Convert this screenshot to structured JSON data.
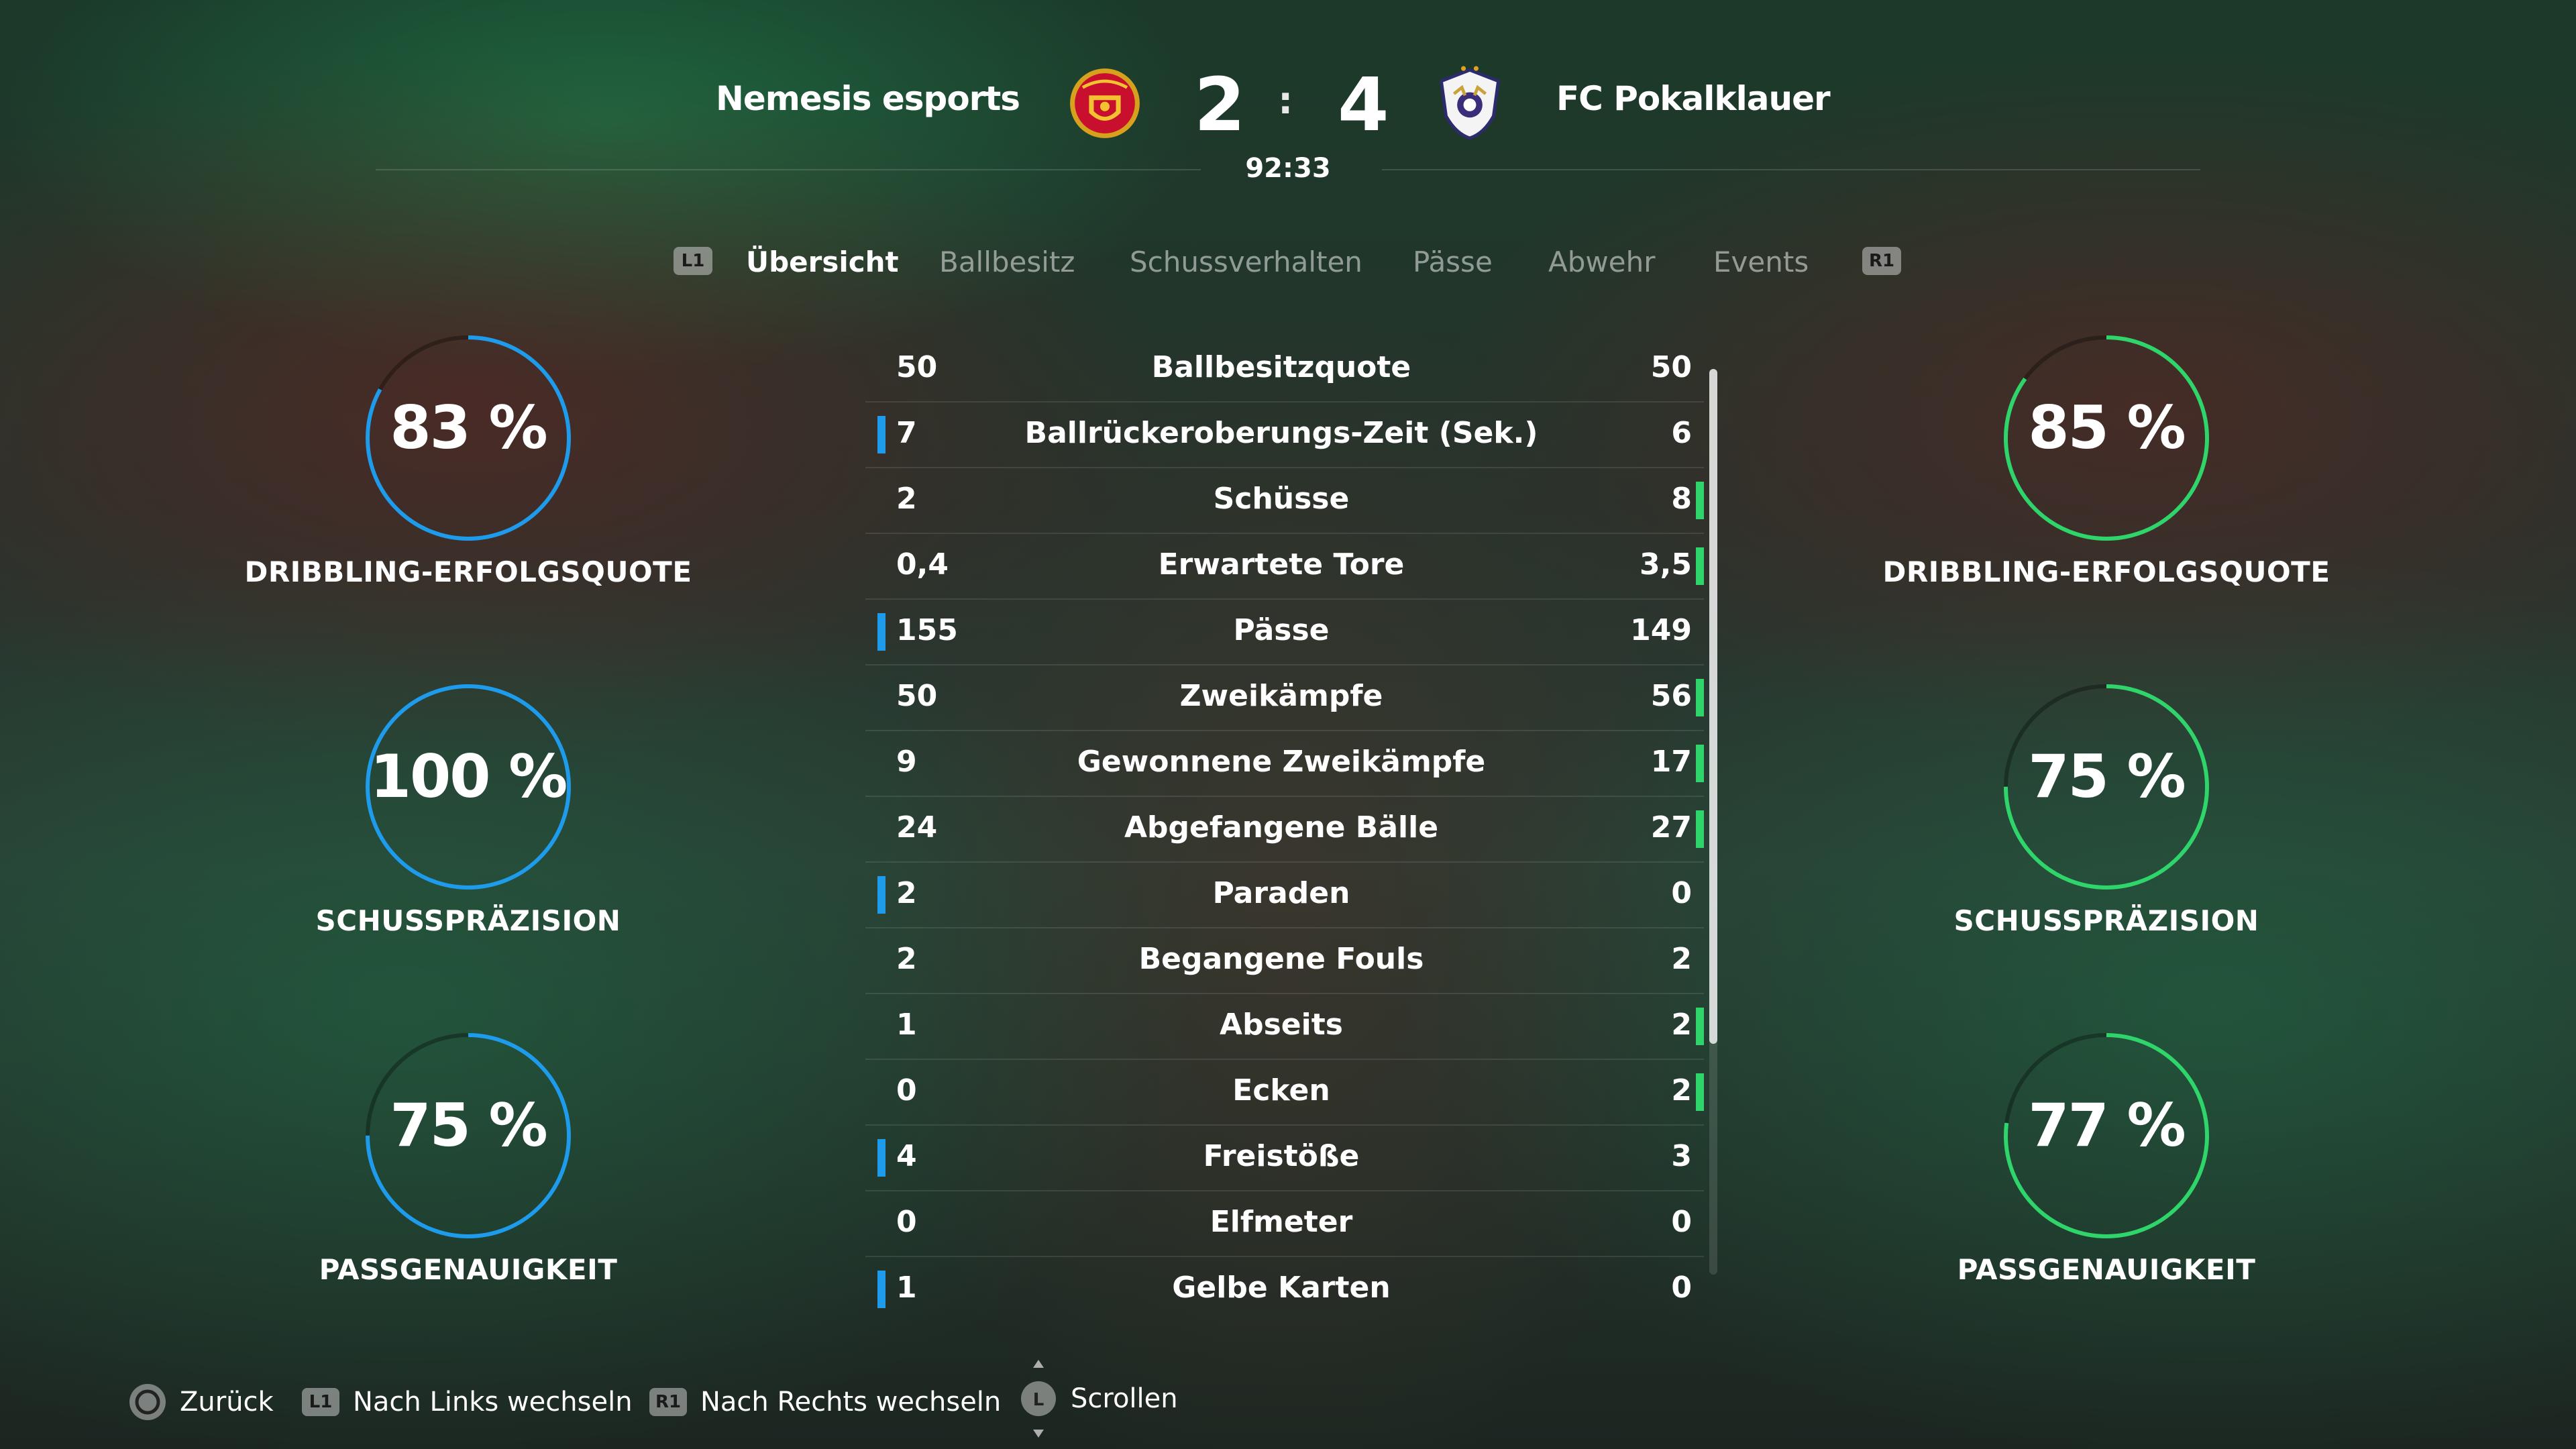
{
  "match": {
    "home_team": "Nemesis esports",
    "away_team": "FC Pokalklauer",
    "home_score": "2",
    "away_score": "4",
    "separator": ":",
    "clock": "92:33",
    "home_color": "#1e9bea",
    "away_color": "#2fd56a"
  },
  "tabs": {
    "prev_key": "L1",
    "next_key": "R1",
    "items": [
      {
        "label": "Übersicht",
        "active": true
      },
      {
        "label": "Ballbesitz",
        "active": false
      },
      {
        "label": "Schussverhalten",
        "active": false
      },
      {
        "label": "Pässe",
        "active": false
      },
      {
        "label": "Abwehr",
        "active": false
      },
      {
        "label": "Events",
        "active": false
      }
    ]
  },
  "home_rings": [
    {
      "value": "83 %",
      "pct": 0.83,
      "label": "DRIBBLING-ERFOLGSQUOTE"
    },
    {
      "value": "100 %",
      "pct": 1.0,
      "label": "SCHUSSPRÄZISION"
    },
    {
      "value": "75 %",
      "pct": 0.75,
      "label": "PASSGENAUIGKEIT"
    }
  ],
  "away_rings": [
    {
      "value": "85 %",
      "pct": 0.85,
      "label": "DRIBBLING-ERFOLGSQUOTE"
    },
    {
      "value": "75 %",
      "pct": 0.75,
      "label": "SCHUSSPRÄZISION"
    },
    {
      "value": "77 %",
      "pct": 0.77,
      "label": "PASSGENAUIGKEIT"
    }
  ],
  "stats": [
    {
      "name": "Ballbesitzquote",
      "home": "50",
      "away": "50",
      "leader": "none"
    },
    {
      "name": "Ballrückeroberungs-Zeit (Sek.)",
      "home": "7",
      "away": "6",
      "leader": "home"
    },
    {
      "name": "Schüsse",
      "home": "2",
      "away": "8",
      "leader": "away"
    },
    {
      "name": "Erwartete Tore",
      "home": "0,4",
      "away": "3,5",
      "leader": "away"
    },
    {
      "name": "Pässe",
      "home": "155",
      "away": "149",
      "leader": "home"
    },
    {
      "name": "Zweikämpfe",
      "home": "50",
      "away": "56",
      "leader": "away"
    },
    {
      "name": "Gewonnene Zweikämpfe",
      "home": "9",
      "away": "17",
      "leader": "away"
    },
    {
      "name": "Abgefangene Bälle",
      "home": "24",
      "away": "27",
      "leader": "away"
    },
    {
      "name": "Paraden",
      "home": "2",
      "away": "0",
      "leader": "home"
    },
    {
      "name": "Begangene Fouls",
      "home": "2",
      "away": "2",
      "leader": "none"
    },
    {
      "name": "Abseits",
      "home": "1",
      "away": "2",
      "leader": "away"
    },
    {
      "name": "Ecken",
      "home": "0",
      "away": "2",
      "leader": "away"
    },
    {
      "name": "Freistöße",
      "home": "4",
      "away": "3",
      "leader": "home"
    },
    {
      "name": "Elfmeter",
      "home": "0",
      "away": "0",
      "leader": "none"
    },
    {
      "name": "Gelbe Karten",
      "home": "1",
      "away": "0",
      "leader": "home"
    }
  ],
  "footer": {
    "back": "Zurück",
    "left_key": "L1",
    "left": "Nach Links wechseln",
    "right_key": "R1",
    "right": "Nach Rechts wechseln",
    "scroll_key": "L",
    "scroll": "Scrollen"
  }
}
